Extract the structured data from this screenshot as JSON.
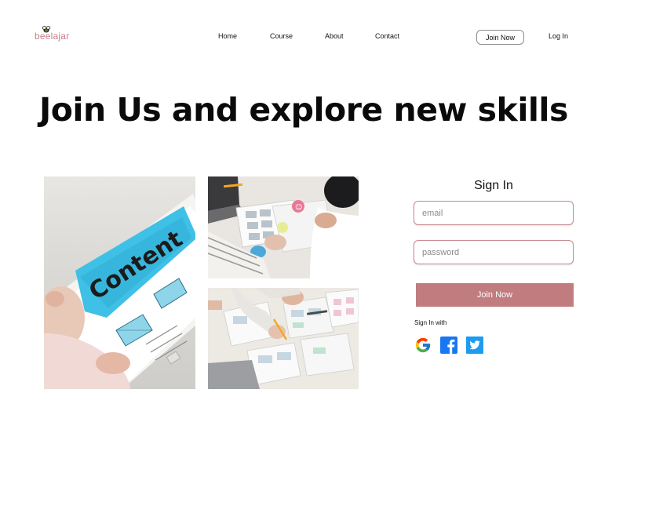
{
  "brand": {
    "name": "beelajar",
    "logo_icon": "bee-icon",
    "color": "#c97e8a"
  },
  "nav": {
    "links": [
      "Home",
      "Course",
      "About",
      "Contact"
    ],
    "join_label": "Join Now",
    "login_label": "Log In"
  },
  "hero": {
    "title": "Join Us and explore new skills"
  },
  "gallery": {
    "images": [
      {
        "icon": "content-wireframe-photo"
      },
      {
        "icon": "team-wireframing-photo"
      },
      {
        "icon": "paper-prototype-photo"
      }
    ],
    "photo_caption": "Content"
  },
  "signin": {
    "title": "Sign In",
    "email_placeholder": "email",
    "password_placeholder": "password",
    "submit_label": "Join Now",
    "with_label": "Sign In with",
    "providers": [
      "google-icon",
      "facebook-icon",
      "twitter-icon"
    ],
    "accent": "#c07c7f"
  }
}
